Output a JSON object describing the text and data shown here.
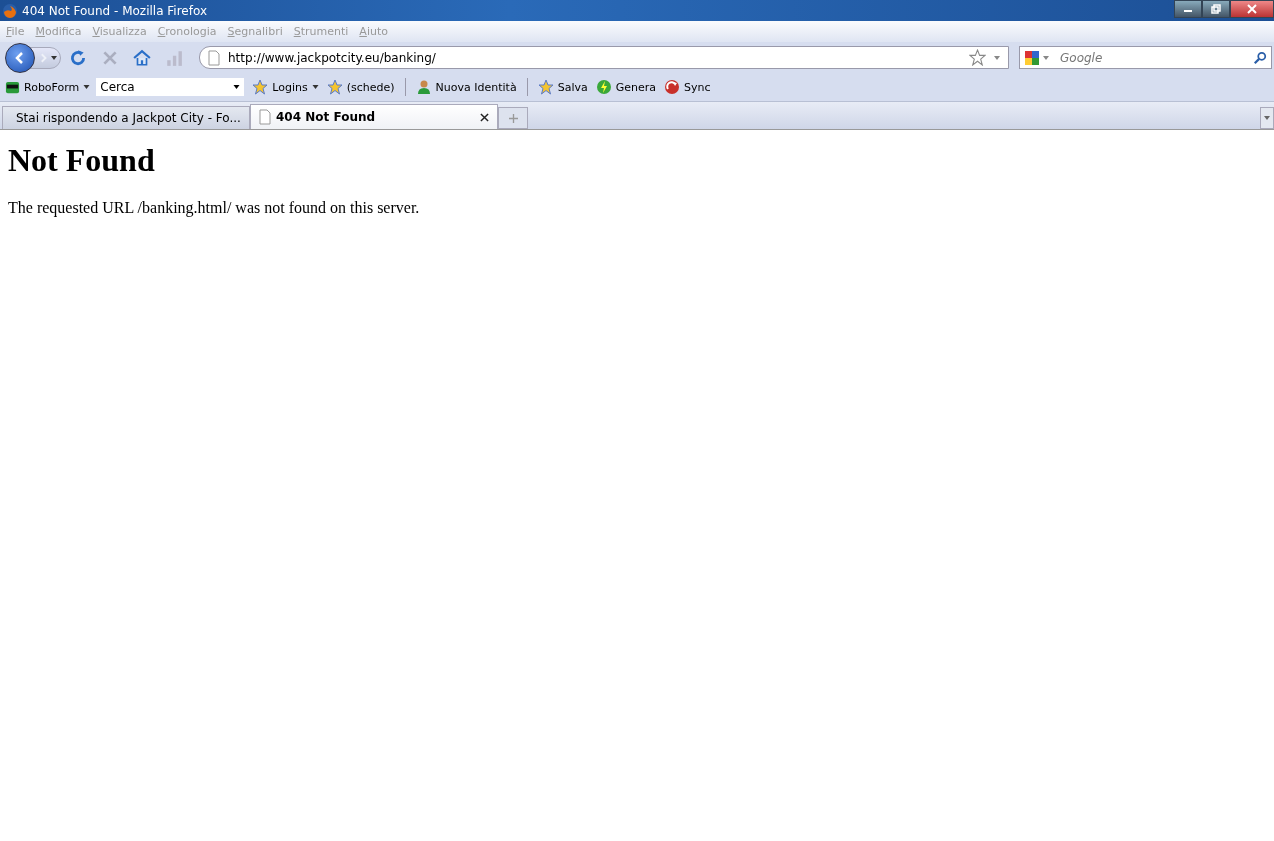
{
  "window": {
    "title": "404 Not Found - Mozilla Firefox"
  },
  "menu": [
    {
      "label": "File"
    },
    {
      "label": "Modifica"
    },
    {
      "label": "Visualizza"
    },
    {
      "label": "Cronologia"
    },
    {
      "label": "Segnalibri"
    },
    {
      "label": "Strumenti"
    },
    {
      "label": "Aiuto"
    }
  ],
  "navigation": {
    "url": "http://www.jackpotcity.eu/banking/",
    "search": {
      "placeholder": "Google"
    },
    "forward_disabled": true,
    "stop_disabled": true
  },
  "roboform": {
    "label": "RoboForm",
    "search": {
      "value": "Cerca"
    },
    "items": [
      {
        "label": "Logins",
        "kind": "dropdown"
      },
      {
        "label": "(schede)",
        "kind": "tabs"
      },
      {
        "kind": "separator"
      },
      {
        "label": "Nuova Identità",
        "kind": "identity"
      },
      {
        "kind": "separator"
      },
      {
        "label": "Salva",
        "kind": "save"
      },
      {
        "label": "Genera",
        "kind": "generate"
      },
      {
        "label": "Sync",
        "kind": "sync"
      }
    ]
  },
  "tabs": [
    {
      "label": "Stai rispondendo a Jackpot City - Fo...",
      "selected": false,
      "kind": "site"
    },
    {
      "label": "404 Not Found",
      "selected": true,
      "kind": "page"
    }
  ],
  "page": {
    "heading": "Not Found",
    "message": "The requested URL /banking.html/ was not found on this server."
  }
}
